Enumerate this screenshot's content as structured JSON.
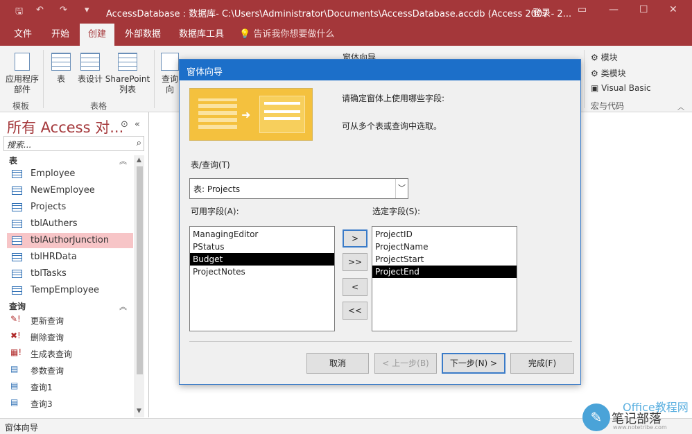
{
  "titlebar": {
    "title": "AccessDatabase : 数据库- C:\\Users\\Administrator\\Documents\\AccessDatabase.accdb (Access 2007 - 2...",
    "login": "登录"
  },
  "tabs": [
    "文件",
    "开始",
    "创建",
    "外部数据",
    "数据库工具"
  ],
  "tellme": "告诉我你想要做什么",
  "ribbon": {
    "template_btn": "应用程序",
    "template_btn2": "部件",
    "table_btn": "表",
    "table_design_btn": "表设计",
    "sharepoint_btn": "SharePoint",
    "sharepoint_btn2": "列表",
    "query_btn": "查询向",
    "form_wizard_btn": "窗体向导",
    "module_btn": "模块",
    "class_module_btn": "类模块",
    "vba_btn": "Visual Basic",
    "group_template": "模板",
    "group_tables": "表格",
    "group_macro": "宏与代码"
  },
  "nav": {
    "title": "所有 Access 对...",
    "search_placeholder": "搜索...",
    "section_tables": "表",
    "tables": [
      "Employee",
      "NewEmployee",
      "Projects",
      "tblAuthers",
      "tblAuthorJunction",
      "tblHRData",
      "tblTasks",
      "TempEmployee"
    ],
    "selected_table": "tblAuthorJunction",
    "section_queries": "查询",
    "queries": [
      "更新查询",
      "删除查询",
      "生成表查询",
      "参数查询",
      "查询1",
      "查询3"
    ]
  },
  "status": "窗体向导",
  "dialog": {
    "title": "窗体向导",
    "line1": "请确定窗体上使用哪些字段:",
    "line2": "可从多个表或查询中选取。",
    "table_query_label": "表/查询(T)",
    "table_query_value": "表: Projects",
    "available_label": "可用字段(A):",
    "selected_label": "选定字段(S):",
    "available_fields": [
      "ManagingEditor",
      "PStatus",
      "Budget",
      "ProjectNotes"
    ],
    "available_selected": "Budget",
    "selected_fields": [
      "ProjectID",
      "ProjectName",
      "ProjectStart",
      "ProjectEnd"
    ],
    "selected_selected": "ProjectEnd",
    "btn_add": ">",
    "btn_add_all": ">>",
    "btn_remove": "<",
    "btn_remove_all": "<<",
    "btn_cancel": "取消",
    "btn_back": "< 上一步(B)",
    "btn_next": "下一步(N) >",
    "btn_finish": "完成(F)"
  },
  "watermark": {
    "brand": "Office教程网",
    "name": "笔记部落",
    "url": "www.notetribe.com"
  }
}
